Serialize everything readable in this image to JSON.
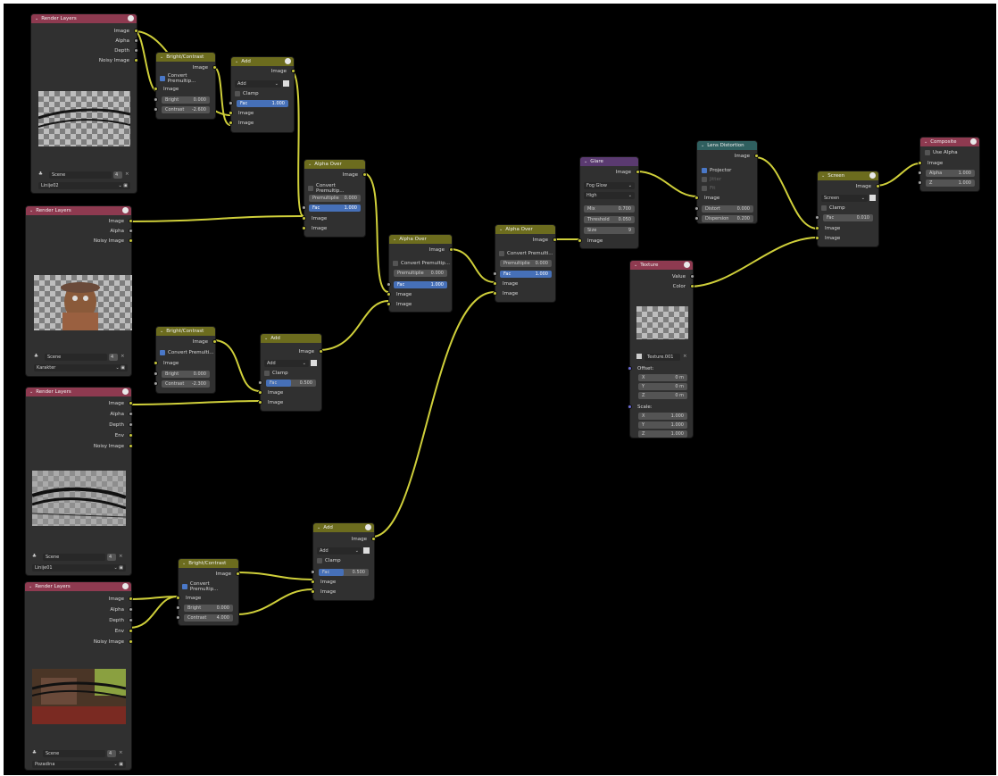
{
  "render_layers": {
    "title": "Render Layers",
    "scene_label": "Scene",
    "scene_users": "4",
    "n1": {
      "outputs": [
        "Image",
        "Alpha",
        "Depth",
        "Noisy Image"
      ],
      "layer": "Linije02"
    },
    "n2": {
      "outputs": [
        "Image",
        "Alpha",
        "Noisy Image"
      ],
      "layer": "Karakter"
    },
    "n3": {
      "outputs": [
        "Image",
        "Alpha",
        "Depth",
        "Env",
        "Noisy Image"
      ],
      "layer": "Linije01"
    },
    "n4": {
      "outputs": [
        "Image",
        "Alpha",
        "Depth",
        "Env",
        "Noisy Image"
      ],
      "layer": "Pozadina"
    }
  },
  "bright_contrast": {
    "title": "Bright/Contrast",
    "out": "Image",
    "in": "Image",
    "bright_label": "Bright",
    "contrast_label": "Contrast",
    "b1": {
      "premult": "Convert Premultip...",
      "bright": "0.000",
      "contrast": "-2.600"
    },
    "b2": {
      "premult": "Convert Premulti...",
      "bright": "0.000",
      "contrast": "-2.300"
    },
    "b3": {
      "premult": "Convert Premultip...",
      "bright": "0.000",
      "contrast": "4.000"
    }
  },
  "add": {
    "title": "Add",
    "out": "Image",
    "mode": "Add",
    "clamp": "Clamp",
    "fac_label": "Fac",
    "in": "Image",
    "a1": {
      "fac": "1.000"
    },
    "a2": {
      "fac": "0.500"
    },
    "a3": {
      "fac": "0.500"
    }
  },
  "alpha_over": {
    "title": "Alpha Over",
    "out": "Image",
    "premult_label": "Premultiplie",
    "fac_label": "Fac",
    "in": "Image",
    "o1": {
      "convert": "Convert Premultip...",
      "premult": "0.000",
      "fac": "1.000"
    },
    "o2": {
      "convert": "Convert Premultip...",
      "premult": "0.000",
      "fac": "1.000"
    },
    "o3": {
      "convert": "Convert Premulti...",
      "premult": "0.000",
      "fac": "1.000"
    }
  },
  "glare": {
    "title": "Glare",
    "out": "Image",
    "type": "Fog Glow",
    "quality": "High",
    "mix_label": "Mix",
    "mix": "0.700",
    "threshold_label": "Threshold",
    "threshold": "0.050",
    "size_label": "Size",
    "size": "9",
    "in": "Image"
  },
  "lens": {
    "title": "Lens Distortion",
    "out": "Image",
    "projector": "Projector",
    "jitter": "Jitter",
    "fit": "Fit",
    "in": "Image",
    "distort_label": "Distort",
    "distort": "0.000",
    "dispersion_label": "Dispersion",
    "dispersion": "0.200"
  },
  "screen": {
    "title": "Screen",
    "out": "Image",
    "mode": "Screen",
    "clamp": "Clamp",
    "fac_label": "Fac",
    "fac": "0.010",
    "in": "Image"
  },
  "composite": {
    "title": "Composite",
    "use_alpha": "Use Alpha",
    "in": "Image",
    "alpha_label": "Alpha",
    "alpha": "1.000",
    "z_label": "Z",
    "z": "1.000"
  },
  "texture": {
    "title": "Texture",
    "value": "Value",
    "color": "Color",
    "tex_name": "Texture.001",
    "offset": "Offset:",
    "scale": "Scale:",
    "x": "X",
    "y": "Y",
    "z": "Z",
    "off_vals": [
      "0 m",
      "0 m",
      "0 m"
    ],
    "scale_vals": [
      "1.000",
      "1.000",
      "1.000"
    ]
  },
  "colors": {
    "input": "#8e3a50",
    "color": "#6c6c1e",
    "filter": "#5a3a70",
    "distort": "#2f5f5f",
    "wire": "#cfcf3a"
  }
}
